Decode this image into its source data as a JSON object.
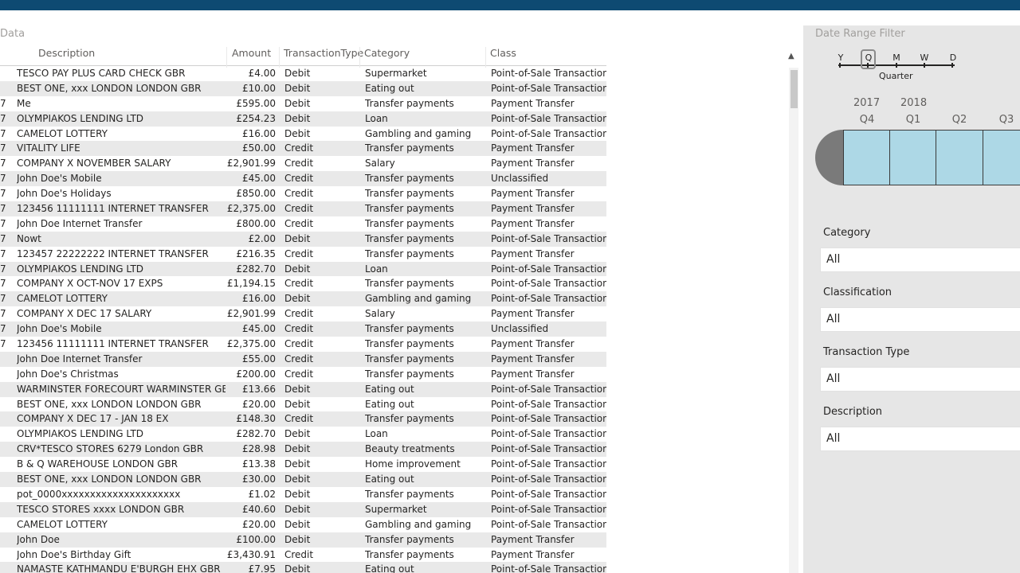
{
  "table": {
    "title": "Data",
    "headers": {
      "description": "Description",
      "amount": "Amount",
      "type": "TransactionType",
      "category": "Category",
      "class": "Class"
    },
    "rows": [
      {
        "date": "",
        "desc": "TESCO PAY PLUS CARD CHECK GBR",
        "amt": "£4.00",
        "type": "Debit",
        "cat": "Supermarket",
        "cls": "Point-of-Sale Transaction"
      },
      {
        "date": "",
        "desc": "BEST ONE, xxx LONDON LONDON GBR",
        "amt": "£10.00",
        "type": "Debit",
        "cat": "Eating out",
        "cls": "Point-of-Sale Transaction"
      },
      {
        "date": "7",
        "desc": "Me",
        "amt": "£595.00",
        "type": "Debit",
        "cat": "Transfer payments",
        "cls": "Payment Transfer"
      },
      {
        "date": "7",
        "desc": "OLYMPIAKOS LENDING LTD",
        "amt": "£254.23",
        "type": "Debit",
        "cat": "Loan",
        "cls": "Point-of-Sale Transaction"
      },
      {
        "date": "7",
        "desc": "CAMELOT LOTTERY",
        "amt": "£16.00",
        "type": "Debit",
        "cat": "Gambling and gaming",
        "cls": "Point-of-Sale Transaction"
      },
      {
        "date": "7",
        "desc": "VITALITY LIFE",
        "amt": "£50.00",
        "type": "Credit",
        "cat": "Transfer payments",
        "cls": "Payment Transfer"
      },
      {
        "date": "7",
        "desc": "COMPANY X NOVEMBER SALARY",
        "amt": "£2,901.99",
        "type": "Credit",
        "cat": "Salary",
        "cls": "Payment Transfer"
      },
      {
        "date": "7",
        "desc": "John Doe's Mobile",
        "amt": "£45.00",
        "type": "Credit",
        "cat": "Transfer payments",
        "cls": "Unclassified"
      },
      {
        "date": "7",
        "desc": "John Doe's Holidays",
        "amt": "£850.00",
        "type": "Credit",
        "cat": "Transfer payments",
        "cls": "Payment Transfer"
      },
      {
        "date": "7",
        "desc": "123456 11111111 INTERNET TRANSFER",
        "amt": "£2,375.00",
        "type": "Credit",
        "cat": "Transfer payments",
        "cls": "Payment Transfer"
      },
      {
        "date": "7",
        "desc": "John Doe Internet Transfer",
        "amt": "£800.00",
        "type": "Credit",
        "cat": "Transfer payments",
        "cls": "Payment Transfer"
      },
      {
        "date": "7",
        "desc": "Nowt",
        "amt": "£2.00",
        "type": "Debit",
        "cat": "Transfer payments",
        "cls": "Point-of-Sale Transaction"
      },
      {
        "date": "7",
        "desc": "123457 22222222 INTERNET TRANSFER",
        "amt": "£216.35",
        "type": "Credit",
        "cat": "Transfer payments",
        "cls": "Payment Transfer"
      },
      {
        "date": "7",
        "desc": "OLYMPIAKOS LENDING LTD",
        "amt": "£282.70",
        "type": "Debit",
        "cat": "Loan",
        "cls": "Point-of-Sale Transaction"
      },
      {
        "date": "7",
        "desc": "COMPANY X OCT-NOV 17 EXPS",
        "amt": "£1,194.15",
        "type": "Credit",
        "cat": "Transfer payments",
        "cls": "Point-of-Sale Transaction"
      },
      {
        "date": "7",
        "desc": "CAMELOT LOTTERY",
        "amt": "£16.00",
        "type": "Debit",
        "cat": "Gambling and gaming",
        "cls": "Point-of-Sale Transaction"
      },
      {
        "date": "7",
        "desc": "COMPANY X DEC 17 SALARY",
        "amt": "£2,901.99",
        "type": "Credit",
        "cat": "Salary",
        "cls": "Payment Transfer"
      },
      {
        "date": "7",
        "desc": "John Doe's Mobile",
        "amt": "£45.00",
        "type": "Credit",
        "cat": "Transfer payments",
        "cls": "Unclassified"
      },
      {
        "date": "7",
        "desc": "123456 11111111 INTERNET TRANSFER",
        "amt": "£2,375.00",
        "type": "Credit",
        "cat": "Transfer payments",
        "cls": "Payment Transfer"
      },
      {
        "date": "",
        "desc": "John Doe Internet Transfer",
        "amt": "£55.00",
        "type": "Credit",
        "cat": "Transfer payments",
        "cls": "Payment Transfer"
      },
      {
        "date": "",
        "desc": "John Doe's Christmas",
        "amt": "£200.00",
        "type": "Credit",
        "cat": "Transfer payments",
        "cls": "Payment Transfer"
      },
      {
        "date": "",
        "desc": "WARMINSTER FORECOURT WARMINSTER GBR",
        "amt": "£13.66",
        "type": "Debit",
        "cat": "Eating out",
        "cls": "Point-of-Sale Transaction"
      },
      {
        "date": "",
        "desc": "BEST ONE, xxx LONDON LONDON GBR",
        "amt": "£20.00",
        "type": "Debit",
        "cat": "Eating out",
        "cls": "Point-of-Sale Transaction"
      },
      {
        "date": "",
        "desc": "COMPANY X DEC 17 - JAN 18 EX",
        "amt": "£148.30",
        "type": "Credit",
        "cat": "Transfer payments",
        "cls": "Point-of-Sale Transaction"
      },
      {
        "date": "",
        "desc": "OLYMPIAKOS LENDING LTD",
        "amt": "£282.70",
        "type": "Debit",
        "cat": "Loan",
        "cls": "Point-of-Sale Transaction"
      },
      {
        "date": "",
        "desc": "CRV*TESCO STORES 6279 London GBR",
        "amt": "£28.98",
        "type": "Debit",
        "cat": "Beauty treatments",
        "cls": "Point-of-Sale Transaction"
      },
      {
        "date": "",
        "desc": "B & Q WAREHOUSE LONDON GBR",
        "amt": "£13.38",
        "type": "Debit",
        "cat": "Home improvement",
        "cls": "Point-of-Sale Transaction"
      },
      {
        "date": "",
        "desc": "BEST ONE, xxx LONDON LONDON GBR",
        "amt": "£30.00",
        "type": "Debit",
        "cat": "Eating out",
        "cls": "Point-of-Sale Transaction"
      },
      {
        "date": "",
        "desc": "pot_0000xxxxxxxxxxxxxxxxxxxxx",
        "amt": "£1.02",
        "type": "Debit",
        "cat": "Transfer payments",
        "cls": "Point-of-Sale Transaction"
      },
      {
        "date": "",
        "desc": "TESCO STORES xxxx LONDON GBR",
        "amt": "£40.60",
        "type": "Debit",
        "cat": "Supermarket",
        "cls": "Point-of-Sale Transaction"
      },
      {
        "date": "",
        "desc": "CAMELOT LOTTERY",
        "amt": "£20.00",
        "type": "Debit",
        "cat": "Gambling and gaming",
        "cls": "Point-of-Sale Transaction"
      },
      {
        "date": "",
        "desc": "John Doe",
        "amt": "£100.00",
        "type": "Debit",
        "cat": "Transfer payments",
        "cls": "Payment Transfer"
      },
      {
        "date": "",
        "desc": "John Doe's Birthday Gift",
        "amt": "£3,430.91",
        "type": "Credit",
        "cat": "Transfer payments",
        "cls": "Payment Transfer"
      },
      {
        "date": "",
        "desc": "NAMASTE KATHMANDU E'BURGH EHX GBR",
        "amt": "£7.95",
        "type": "Debit",
        "cat": "Eating out",
        "cls": "Point-of-Sale Transaction"
      }
    ]
  },
  "date_filter": {
    "title": "Date Range Filter",
    "granularity": [
      "Y",
      "Q",
      "M",
      "W",
      "D"
    ],
    "selected_granularity": "Q",
    "granularity_caption": "Quarter",
    "years": [
      "2017",
      "2018"
    ],
    "quarters": [
      "Q4",
      "Q1",
      "Q2",
      "Q3"
    ]
  },
  "slicers": [
    {
      "label": "Category",
      "value": "All"
    },
    {
      "label": "Classification",
      "value": "All"
    },
    {
      "label": "Transaction Type",
      "value": "All"
    },
    {
      "label": "Description",
      "value": "All"
    }
  ],
  "icons": {
    "scroll_up": "scroll-up-arrow-icon"
  },
  "colors": {
    "header_bar": "#0e4a72",
    "quarter_fill": "#add8e6",
    "filter_pane": "#e6e6e6",
    "row_alt": "#e9e9e9"
  }
}
